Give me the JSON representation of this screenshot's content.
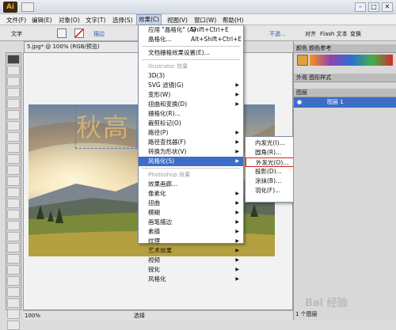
{
  "menubar": {
    "logo": "Ai",
    "items": [
      "文件(F)",
      "编辑(E)",
      "对象(O)",
      "文字(T)",
      "选择(S)",
      "效果(C)",
      "视图(V)",
      "窗口(W)",
      "帮助(H)"
    ],
    "win_buttons": [
      "–",
      "□",
      "✕"
    ]
  },
  "control": {
    "label": "文字",
    "stroke_label": "描边",
    "tail": [
      "不透...",
      "对齐",
      "Flash 文本",
      "变换"
    ]
  },
  "document": {
    "tab": "5.jpg* @ 100% (RGB/预览)",
    "artwork_text": "秋高"
  },
  "effect_menu": {
    "top": [
      {
        "label": "应用 \"晶格化\" (A)",
        "shortcut": "Shift+Ctrl+E"
      },
      {
        "label": "晶格化...",
        "shortcut": "Alt+Shift+Ctrl+E"
      }
    ],
    "doc_raster": "文档栅格效果设置(E)...",
    "illustrator_title": "Illustrator 效果",
    "illustrator_items": [
      "3D(3)",
      "SVG 滤镜(G)",
      "变形(W)",
      "扭曲和变换(D)",
      "栅格化(R)...",
      "裁剪标记(O)",
      "路径(P)",
      "路径查找器(F)",
      "转换为形状(V)",
      "风格化(S)"
    ],
    "photoshop_title": "Photoshop 效果",
    "photoshop_items": [
      "效果画廊...",
      "像素化",
      "扭曲",
      "模糊",
      "画笔描边",
      "素描",
      "纹理",
      "艺术效果",
      "视频",
      "锐化",
      "风格化"
    ],
    "has_submenu": [
      false,
      true,
      true,
      true,
      false,
      false,
      true,
      true,
      true,
      true,
      false,
      true,
      true,
      true,
      true,
      true,
      true,
      true,
      true,
      true,
      true,
      true
    ]
  },
  "stylize_submenu": [
    "内发光(I)...",
    "圆角(R)...",
    "外发光(O)...",
    "投影(D)...",
    "涂抹(B)...",
    "羽化(F)..."
  ],
  "panels": {
    "tabs1": [
      "颜色",
      "颜色参考"
    ],
    "tabs2": [
      "外观",
      "图形样式"
    ],
    "layers_tab": "图层",
    "layer_name": "图层 1",
    "layer_count": "1 个图层"
  },
  "status": {
    "zoom": "100%",
    "tool": "选择"
  },
  "watermark": "Bai 经验"
}
